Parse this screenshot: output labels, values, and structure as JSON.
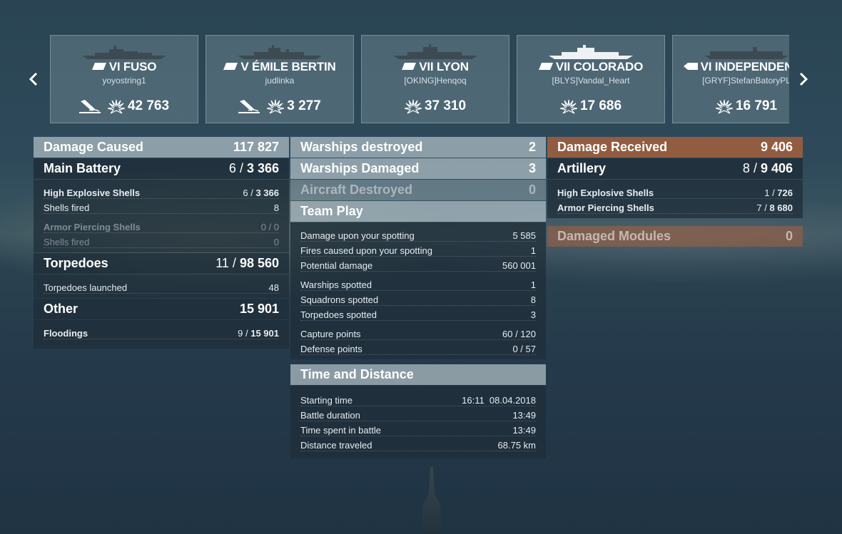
{
  "ships": [
    {
      "tier_name": "VI FUSO",
      "player": "yoyostring1",
      "sunk": true,
      "damage": "42 763",
      "class": "battleship"
    },
    {
      "tier_name": "V ÉMILE BERTIN",
      "player": "judlinka",
      "sunk": true,
      "damage": "3 277",
      "class": "cruiser"
    },
    {
      "tier_name": "VII LYON",
      "player": "[OKING]Henqoq",
      "sunk": false,
      "damage": "37 310",
      "class": "battleship"
    },
    {
      "tier_name": "VII COLORADO",
      "player": "[BLYS]Vandal_Heart",
      "sunk": false,
      "damage": "17 686",
      "class": "battleship"
    },
    {
      "tier_name": "VI INDEPENDENCE",
      "player": "[GRYF]StefanBatoryPL",
      "sunk": false,
      "damage": "16 791",
      "class": "carrier"
    }
  ],
  "damage_caused": {
    "title": "Damage Caused",
    "total": "117 827",
    "main_battery": {
      "label": "Main Battery",
      "hits": "6",
      "value": "3 366"
    },
    "he_shells": {
      "label": "High Explosive Shells",
      "hits": "6",
      "value": "3 366"
    },
    "he_fired": {
      "label": "Shells fired",
      "value": "8"
    },
    "ap_shells": {
      "label": "Armor Piercing Shells",
      "hits": "0",
      "value": "0"
    },
    "ap_fired": {
      "label": "Shells fired",
      "value": "0"
    },
    "torpedoes": {
      "label": "Torpedoes",
      "hits": "11",
      "value": "98 560"
    },
    "torp_launched": {
      "label": "Torpedoes launched",
      "value": "48"
    },
    "other": {
      "label": "Other",
      "value": "15 901"
    },
    "floodings": {
      "label": "Floodings",
      "hits": "9",
      "value": "15 901"
    }
  },
  "middle": {
    "warships_destroyed": {
      "label": "Warships destroyed",
      "value": "2"
    },
    "warships_damaged": {
      "label": "Warships Damaged",
      "value": "3"
    },
    "aircraft_destroyed": {
      "label": "Aircraft Destroyed",
      "value": "0"
    },
    "team_play": {
      "title": "Team Play",
      "rows": [
        {
          "label": "Damage upon your spotting",
          "value": "5 585"
        },
        {
          "label": "Fires caused upon your spotting",
          "value": "1"
        },
        {
          "label": "Potential damage",
          "value": "560 001"
        },
        {
          "label": "Warships spotted",
          "value": "1"
        },
        {
          "label": "Squadrons spotted",
          "value": "8"
        },
        {
          "label": "Torpedoes spotted",
          "value": "3"
        },
        {
          "label": "Capture points",
          "value": "60 / 120"
        },
        {
          "label": "Defense points",
          "value": "0 / 57"
        }
      ]
    },
    "time_distance": {
      "title": "Time and Distance",
      "rows": [
        {
          "label": "Starting time",
          "value": "16:11  08.04.2018"
        },
        {
          "label": "Battle duration",
          "value": "13:49"
        },
        {
          "label": "Time spent in battle",
          "value": "13:49"
        },
        {
          "label": "Distance traveled",
          "value": "68.75 km"
        }
      ]
    }
  },
  "damage_received": {
    "title": "Damage Received",
    "total": "9 406",
    "artillery": {
      "label": "Artillery",
      "hits": "8",
      "value": "9 406"
    },
    "he_shells": {
      "label": "High Explosive Shells",
      "hits": "1",
      "value": "726"
    },
    "ap_shells": {
      "label": "Armor Piercing Shells",
      "hits": "7",
      "value": "8 680"
    },
    "damaged_modules": {
      "label": "Damaged Modules",
      "value": "0"
    }
  },
  "colors": {
    "accent_orange": "#a8603c",
    "panel_dark": "#1e2d38",
    "panel_light": "#b2c0c8"
  }
}
